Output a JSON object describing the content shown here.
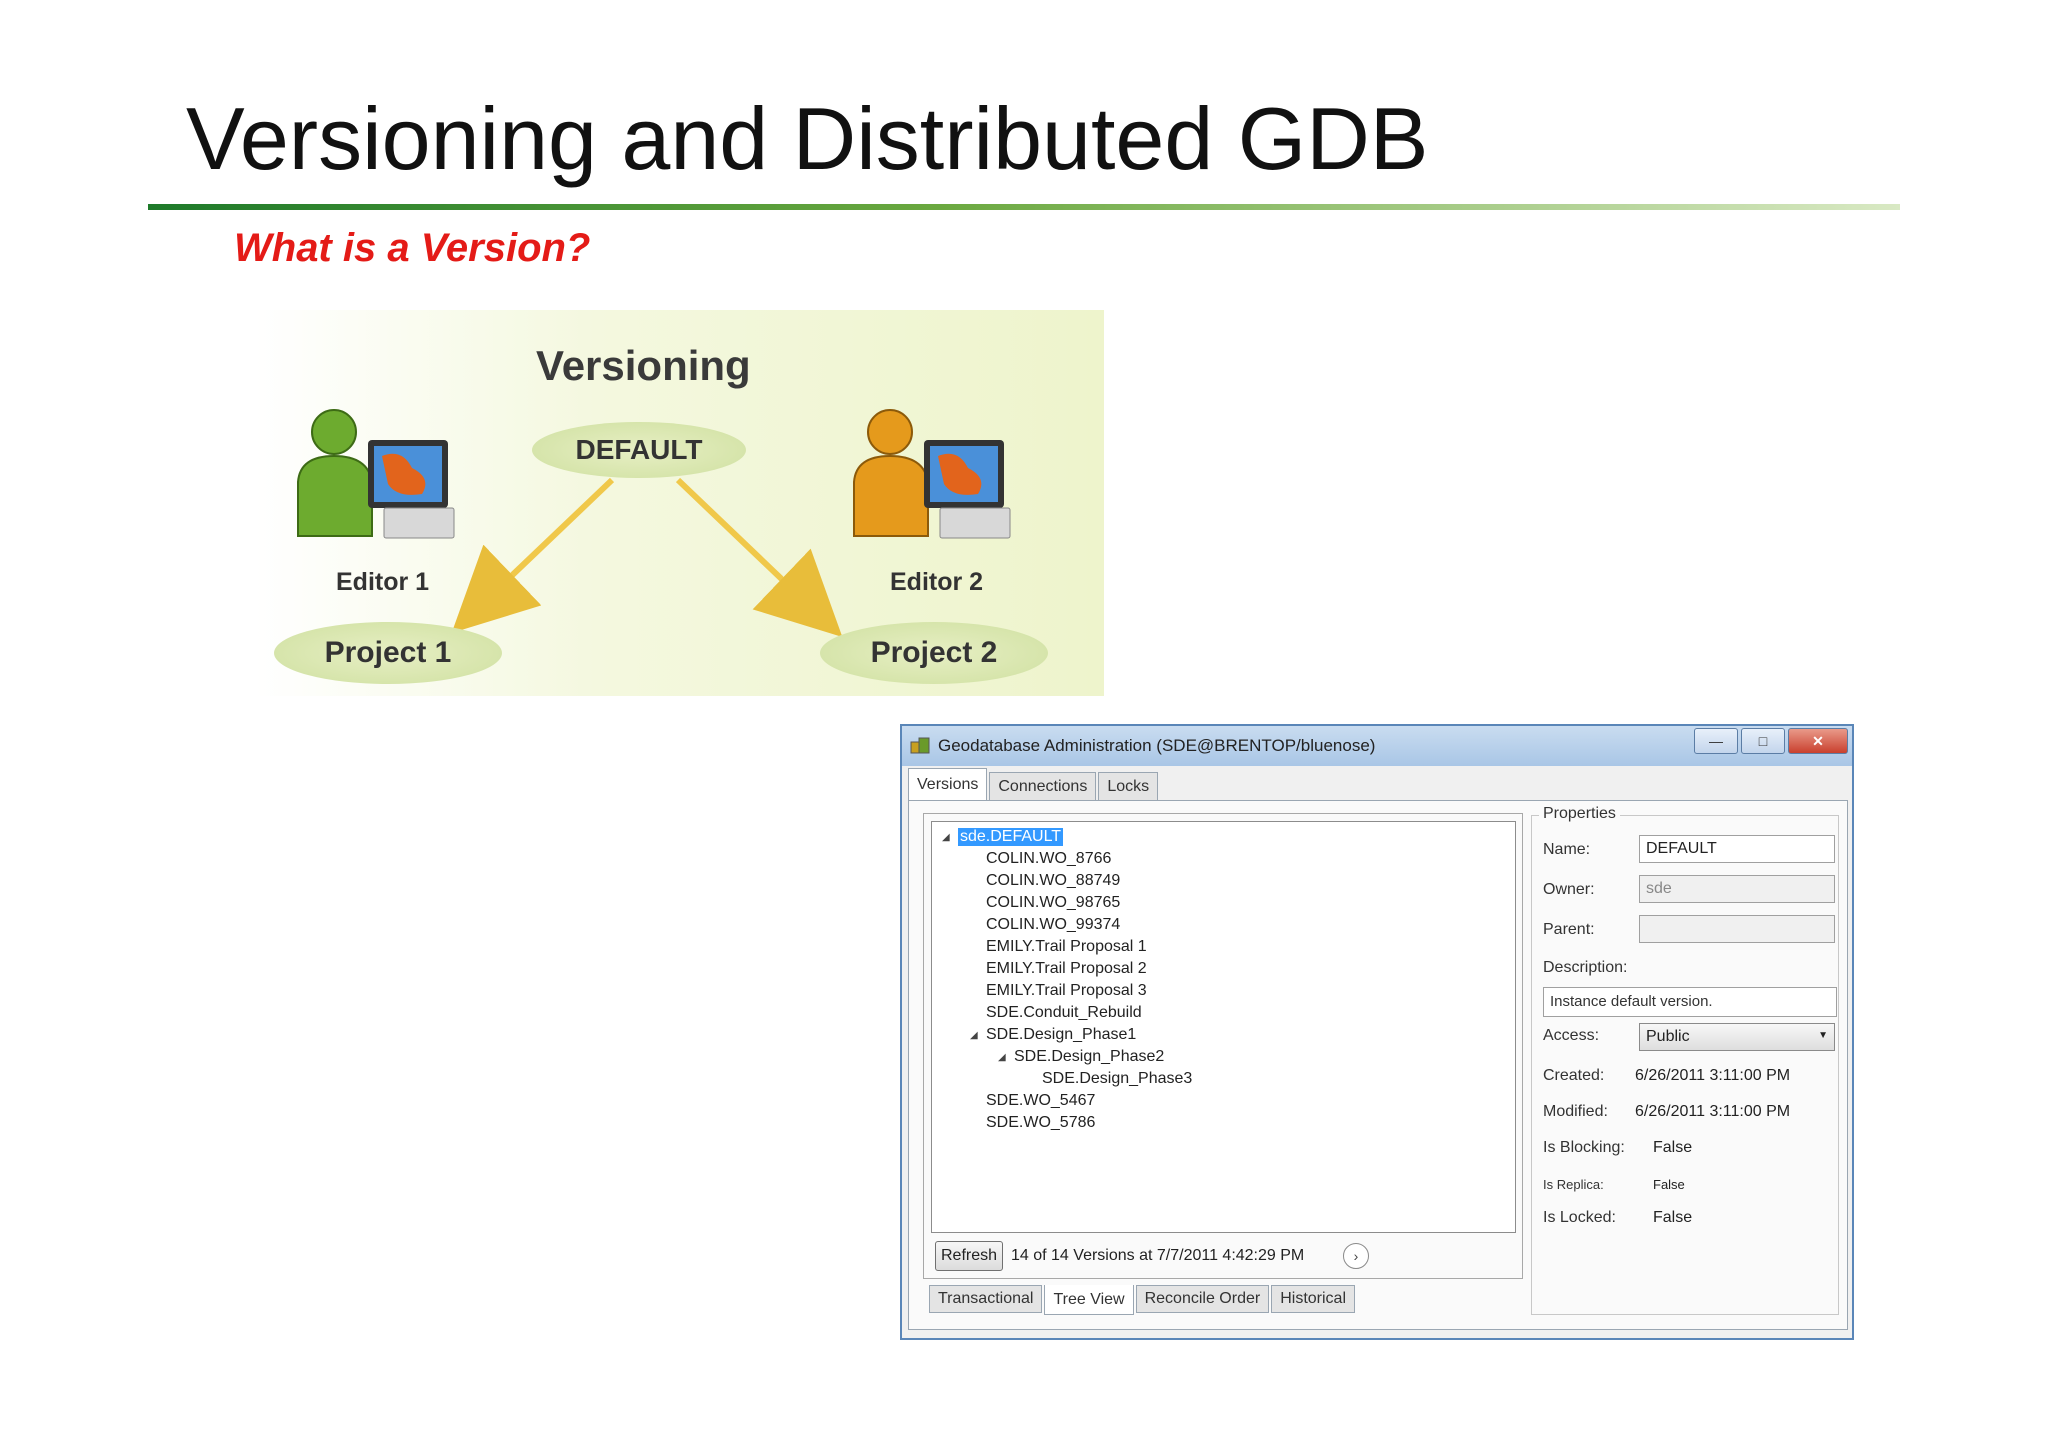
{
  "slide": {
    "title": "Versioning and Distributed GDB",
    "subtitle": "What is a Version?"
  },
  "diagram": {
    "title": "Versioning",
    "default_label": "DEFAULT",
    "editor1_label": "Editor 1",
    "editor2_label": "Editor 2",
    "project1_label": "Project 1",
    "project2_label": "Project 2",
    "editor1_color": "#6dab2f",
    "editor2_color": "#e59a1c",
    "arrow_color": "#f0c84a"
  },
  "dialog": {
    "title": "Geodatabase Administration (SDE@BRENTOP/bluenose)",
    "win_buttons": {
      "minimize": "—",
      "maximize": "□",
      "close": "✕"
    },
    "tabs": [
      "Versions",
      "Connections",
      "Locks"
    ],
    "tree": {
      "root": "sde.DEFAULT",
      "items": [
        "COLIN.WO_8766",
        "COLIN.WO_88749",
        "COLIN.WO_98765",
        "COLIN.WO_99374",
        "EMILY.Trail Proposal 1",
        "EMILY.Trail Proposal 2",
        "EMILY.Trail Proposal 3",
        "SDE.Conduit_Rebuild",
        "SDE.Design_Phase1",
        "SDE.Design_Phase2",
        "SDE.Design_Phase3",
        "SDE.WO_5467",
        "SDE.WO_5786"
      ]
    },
    "refresh_label": "Refresh",
    "status": "14 of 14 Versions at 7/7/2011 4:42:29 PM",
    "bottom_tabs": [
      "Transactional",
      "Tree View",
      "Reconcile Order",
      "Historical"
    ],
    "properties": {
      "legend": "Properties",
      "name_label": "Name:",
      "name_value": "DEFAULT",
      "owner_label": "Owner:",
      "owner_value": "sde",
      "parent_label": "Parent:",
      "parent_value": "",
      "description_label": "Description:",
      "description_value": "Instance default version.",
      "access_label": "Access:",
      "access_value": "Public",
      "created_label": "Created:",
      "created_value": "6/26/2011 3:11:00 PM",
      "modified_label": "Modified:",
      "modified_value": "6/26/2011 3:11:00 PM",
      "blocking_label": "Is Blocking:",
      "blocking_value": "False",
      "replica_label": "Is Replica:",
      "replica_value": "False",
      "locked_label": "Is Locked:",
      "locked_value": "False"
    }
  }
}
